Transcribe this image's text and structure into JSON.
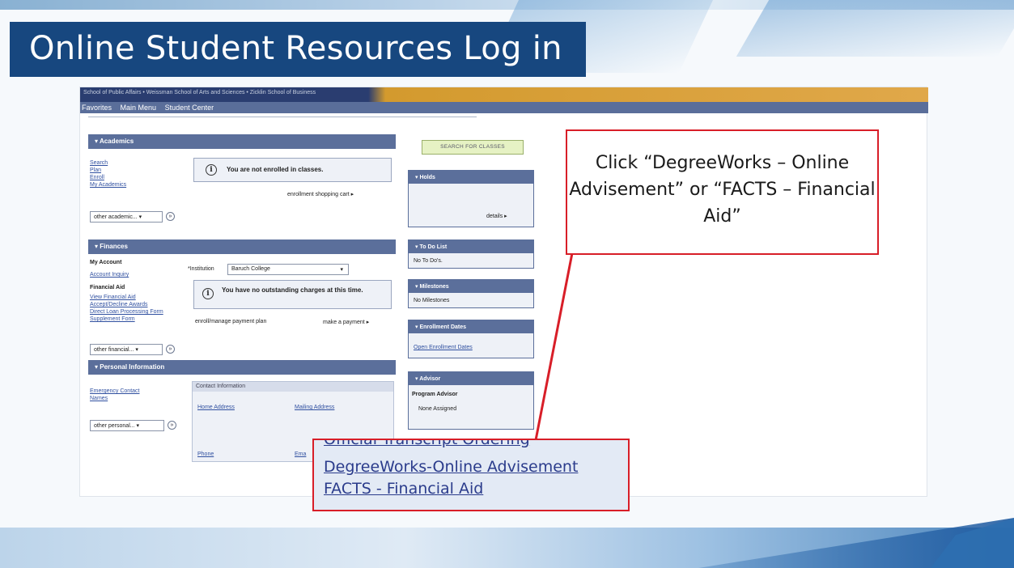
{
  "slide": {
    "title": "Online Student Resources Log in"
  },
  "portal": {
    "top_strip_text": "School of Public Affairs • Weissman School of Arts and Sciences • Zicklin School of Business",
    "nav": [
      "Favorites",
      "Main Menu",
      "Student Center"
    ],
    "academics": {
      "header": "Academics",
      "links": [
        "Search",
        "Plan",
        "Enroll",
        "My Academics"
      ],
      "message": "You are not enrolled in classes.",
      "cart_link": "enrollment shopping cart",
      "other_select": "other academic..."
    },
    "finances": {
      "header": "Finances",
      "my_account_label": "My Account",
      "account_inquiry": "Account Inquiry",
      "financial_aid_label": "Financial Aid",
      "aid_links": [
        "View Financial Aid",
        "Accept/Decline Awards",
        "Direct Loan Processing Form",
        "Supplement Form"
      ],
      "institution_label": "*Institution",
      "institution_value": "Baruch College",
      "message": "You have no outstanding charges at this time.",
      "payment_plan_link": "enroll/manage payment plan",
      "make_payment_link": "make a payment",
      "other_select": "other financial..."
    },
    "personal": {
      "header": "Personal Information",
      "links": [
        "Emergency Contact",
        "Names"
      ],
      "contact_header": "Contact Information",
      "home_address": "Home Address",
      "mailing_address": "Mailing Address",
      "phone": "Phone",
      "email": "Ema",
      "other_select": "other personal..."
    },
    "search_button": "SEARCH FOR CLASSES",
    "holds": {
      "header": "Holds",
      "details_link": "details"
    },
    "todo": {
      "header": "To Do List",
      "text": "No To Do's."
    },
    "milestones": {
      "header": "Milestones",
      "text": "No Milestones"
    },
    "enrollment_dates": {
      "header": "Enrollment Dates",
      "link": "Open Enrollment Dates"
    },
    "advisor": {
      "header": "Advisor",
      "label": "Program Advisor",
      "value": "None Assigned"
    }
  },
  "callouts": {
    "instruction": "Click “DegreeWorks – Online Advisement” or “FACTS – Financial Aid”",
    "links": [
      "Official Transcript Ordering",
      "DegreeWorks-Online Advisement",
      "FACTS - Financial Aid"
    ]
  },
  "colors": {
    "title_bg": "#17477f",
    "callout_border": "#d81e28",
    "portal_header": "#5b6f9b",
    "link": "#2b3c8c"
  }
}
